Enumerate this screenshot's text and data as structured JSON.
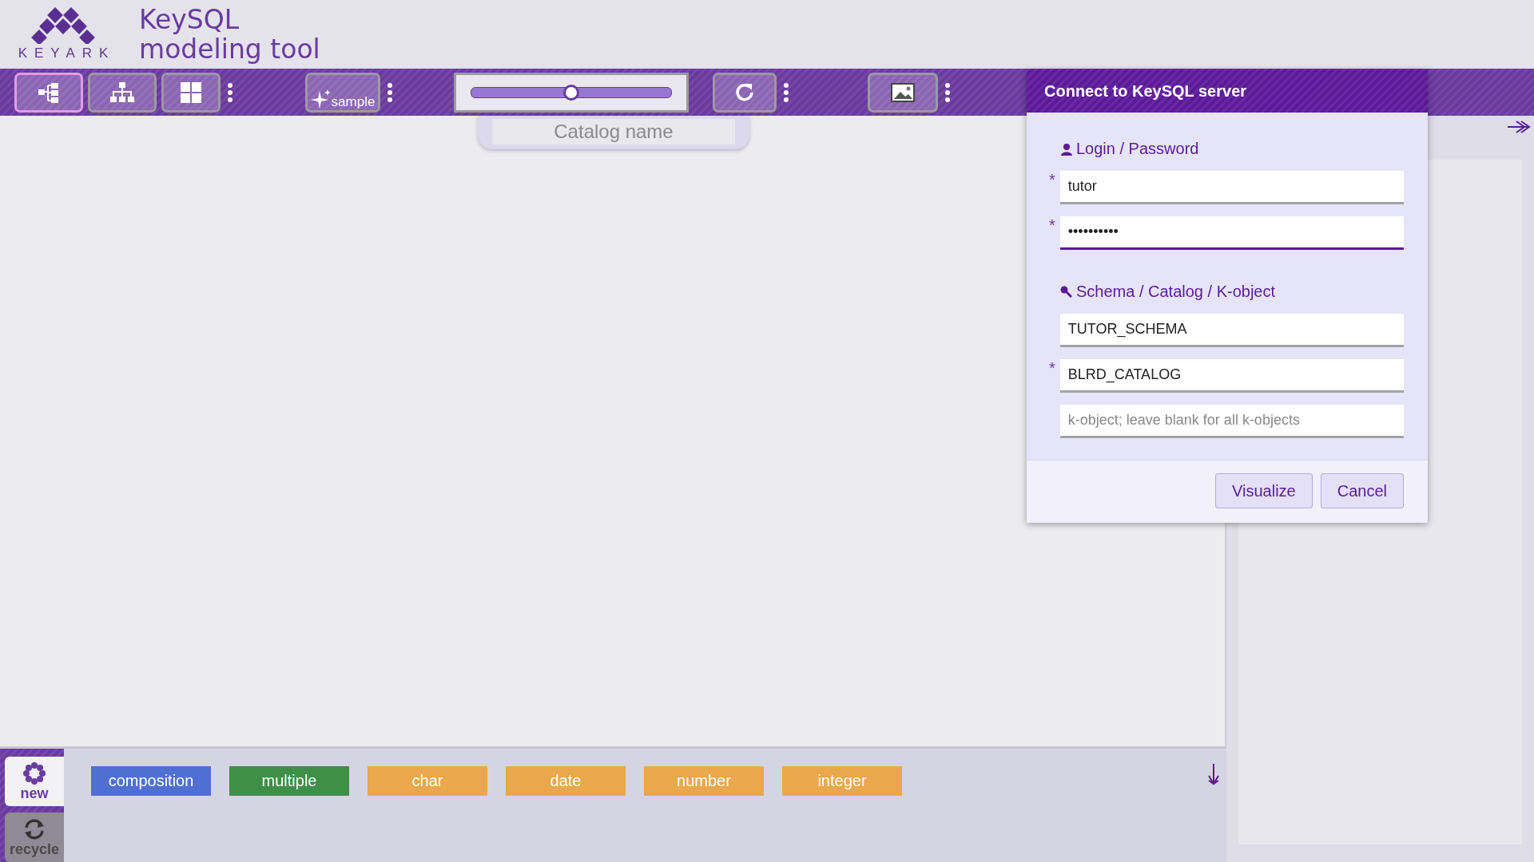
{
  "app": {
    "brand": "KEYARK",
    "title_line_1": "KeySQL",
    "title_line_2": "modeling tool"
  },
  "toolbar": {
    "view_buttons": [
      {
        "selected": true
      },
      {
        "selected": false
      },
      {
        "selected": false
      }
    ],
    "sample_button": {
      "label": "sample"
    },
    "zoom_slider": {
      "level": 0.5
    },
    "catalog_name": {
      "placeholder": "Catalog name"
    }
  },
  "dialog": {
    "title": "Connect to KeySQL server",
    "sections": [
      {
        "label": "Login / Password",
        "fields": [
          {
            "value": "tutor",
            "required_mark": "*",
            "focused": false
          },
          {
            "value": "••••••••••",
            "required_mark": "*",
            "focused": true
          }
        ]
      },
      {
        "label": "Schema / Catalog / K-object",
        "fields": [
          {
            "value": "TUTOR_SCHEMA",
            "focused": false
          },
          {
            "value": "BLRD_CATALOG",
            "required_mark": "*",
            "focused": false
          },
          {
            "placeholder": "k-object; leave blank for all k-objects",
            "focused": false
          }
        ]
      }
    ],
    "buttons": [
      "Visualize",
      "Cancel"
    ]
  },
  "palette": {
    "side_buttons": [
      {
        "label": "new",
        "selected": true
      },
      {
        "label": "recycle",
        "selected": false
      }
    ],
    "tags": [
      {
        "label": "composition",
        "color": "#4f6fd2"
      },
      {
        "label": "multiple",
        "color": "#3f8f48"
      },
      {
        "label": "char",
        "color": "#e9a84c"
      },
      {
        "label": "date",
        "color": "#e9a84c"
      },
      {
        "label": "number",
        "color": "#e9a84c"
      },
      {
        "label": "integer",
        "color": "#e9a84c"
      }
    ]
  }
}
